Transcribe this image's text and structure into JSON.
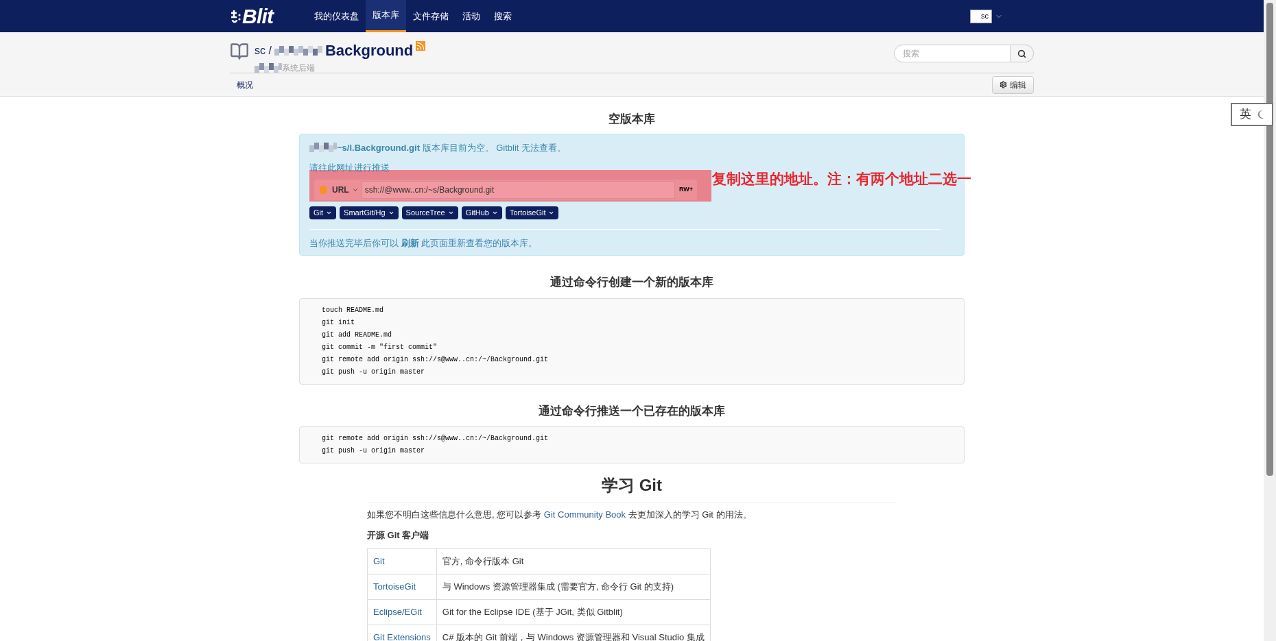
{
  "nav": {
    "logo": "Blit",
    "items": [
      {
        "label": "我的仪表盘",
        "selected": false
      },
      {
        "label": "版本库",
        "selected": true
      },
      {
        "label": "文件存储",
        "selected": false
      },
      {
        "label": "活动",
        "selected": false
      },
      {
        "label": "搜索",
        "selected": false
      }
    ],
    "avatar_alt": "sc"
  },
  "repo": {
    "owner": "sc /",
    "name": "Background",
    "description": "系统后端",
    "search_placeholder": "搜索",
    "tabs": [
      {
        "label": "概况",
        "selected": true
      }
    ],
    "edit_button": "编辑"
  },
  "empty": {
    "title": "空版本库",
    "notice_path": "~s/l.Background.git",
    "notice_rest": "版本库目前为空。",
    "notice_link": "Gitblit",
    "notice_tail": "无法查看。",
    "push_label": "请往此网址进行推送",
    "protocol": "URL",
    "url": "ssh://@www..cn:/~s/Background.git",
    "permission": "RW+",
    "clients": [
      "Git",
      "SmartGit/Hg",
      "SourceTree",
      "GitHub",
      "TortoiseGit"
    ],
    "after_text": "当你推送完毕后你可以",
    "refresh": "刷新",
    "after_tail": "此页面重新查看您的版本库。"
  },
  "annotation": "复制这里的地址。注：有两个地址二选一",
  "new_repo": {
    "title": "通过命令行创建一个新的版本库",
    "lines": [
      "touch README.md",
      "git init",
      "git add README.md",
      "git commit -m \"first commit\"",
      "git remote add origin ssh://s@www..cn:/~/Background.git",
      "git push -u origin master"
    ]
  },
  "existing_repo": {
    "title": "通过命令行推送一个已存在的版本库",
    "lines": [
      "git remote add origin ssh://s@www..cn:/~/Background.git",
      "git push -u origin master"
    ]
  },
  "learn": {
    "title": "学习 Git",
    "intro": "如果您不明白这些信息什么意思, 您可以参考",
    "intro_link": "Git Community Book",
    "intro_tail": "去更加深入的学习 Git 的用法。",
    "clients_title": "开源 Git 客户端",
    "rows": [
      {
        "name": "Git",
        "desc": "官方, 命令行版本 Git"
      },
      {
        "name": "TortoiseGit",
        "desc": "与 Windows 资源管理器集成 (需要官方, 命令行 Git 的支持)"
      },
      {
        "name": "Eclipse/EGit",
        "desc": "Git for the Eclipse IDE (基于 JGit, 类似 Gitblit)"
      },
      {
        "name": "Git Extensions",
        "desc": "C# 版本的 Git 前端，与 Windows 资源管理器和 Visual Studio 集成"
      }
    ]
  },
  "ime": {
    "mode": "英"
  }
}
